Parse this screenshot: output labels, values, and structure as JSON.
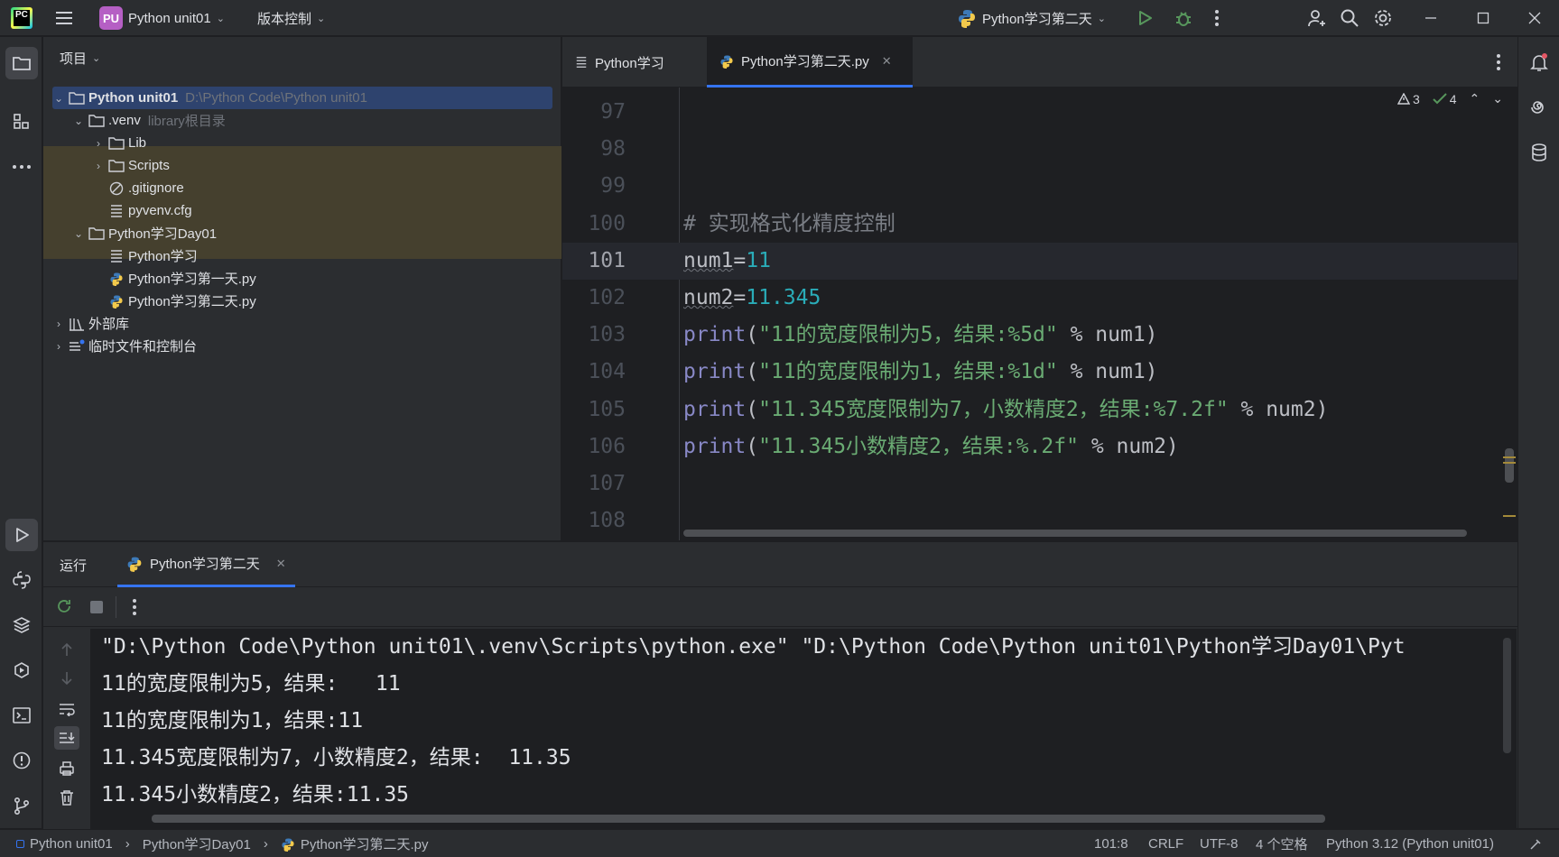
{
  "titlebar": {
    "project_badge": "PU",
    "project_name": "Python unit01",
    "vcs_label": "版本控制",
    "run_config": "Python学习第二天"
  },
  "project_panel": {
    "title": "项目",
    "tree": {
      "root_name": "Python unit01",
      "root_path": "D:\\Python Code\\Python unit01",
      "venv": ".venv",
      "venv_hint": "library根目录",
      "lib": "Lib",
      "scripts": "Scripts",
      "gitignore": ".gitignore",
      "pyvenv": "pyvenv.cfg",
      "day01": "Python学习Day01",
      "file_text": "Python学习",
      "file_day1": "Python学习第一天.py",
      "file_day2": "Python学习第二天.py",
      "external_libs": "外部库",
      "scratches": "临时文件和控制台"
    }
  },
  "editor": {
    "tabs": [
      {
        "label": "Python学习"
      },
      {
        "label": "Python学习第二天.py"
      }
    ],
    "inspections": {
      "warnings": "3",
      "ok": "4"
    },
    "lines": [
      {
        "no": "97"
      },
      {
        "no": "98"
      },
      {
        "no": "99"
      },
      {
        "no": "100",
        "comment": "# 实现格式化精度控制"
      },
      {
        "no": "101",
        "var": "num1",
        "op": "=",
        "val": "11"
      },
      {
        "no": "102",
        "var": "num2",
        "op": "=",
        "val": "11.345"
      },
      {
        "no": "103",
        "fn": "print",
        "open": "(",
        "str": "\"11的宽度限制为5，结果:%5d\"",
        "rest": " % num1)"
      },
      {
        "no": "104",
        "fn": "print",
        "open": "(",
        "str": "\"11的宽度限制为1，结果:%1d\"",
        "rest": " % num1)"
      },
      {
        "no": "105",
        "fn": "print",
        "open": "(",
        "str": "\"11.345宽度限制为7，小数精度2，结果:%7.2f\"",
        "rest": " % num2)"
      },
      {
        "no": "106",
        "fn": "print",
        "open": "(",
        "str": "\"11.345小数精度2，结果:%.2f\"",
        "rest": " % num2)"
      },
      {
        "no": "107"
      },
      {
        "no": "108"
      }
    ]
  },
  "run_panel": {
    "label": "运行",
    "tab": "Python学习第二天",
    "console": [
      "\"D:\\Python Code\\Python unit01\\.venv\\Scripts\\python.exe\" \"D:\\Python Code\\Python unit01\\Python学习Day01\\Pyt",
      "11的宽度限制为5，结果:   11",
      "11的宽度限制为1，结果:11",
      "11.345宽度限制为7，小数精度2，结果:  11.35",
      "11.345小数精度2，结果:11.35"
    ]
  },
  "statusbar": {
    "crumb1": "Python unit01",
    "crumb2": "Python学习Day01",
    "crumb3": "Python学习第二天.py",
    "position": "101:8",
    "line_sep": "CRLF",
    "encoding": "UTF-8",
    "indent": "4 个空格",
    "interpreter": "Python 3.12 (Python unit01)"
  },
  "colors": {
    "accent": "#3574f0",
    "keyword": "#8888c6",
    "string": "#6aab73",
    "number": "#2aacb8"
  }
}
